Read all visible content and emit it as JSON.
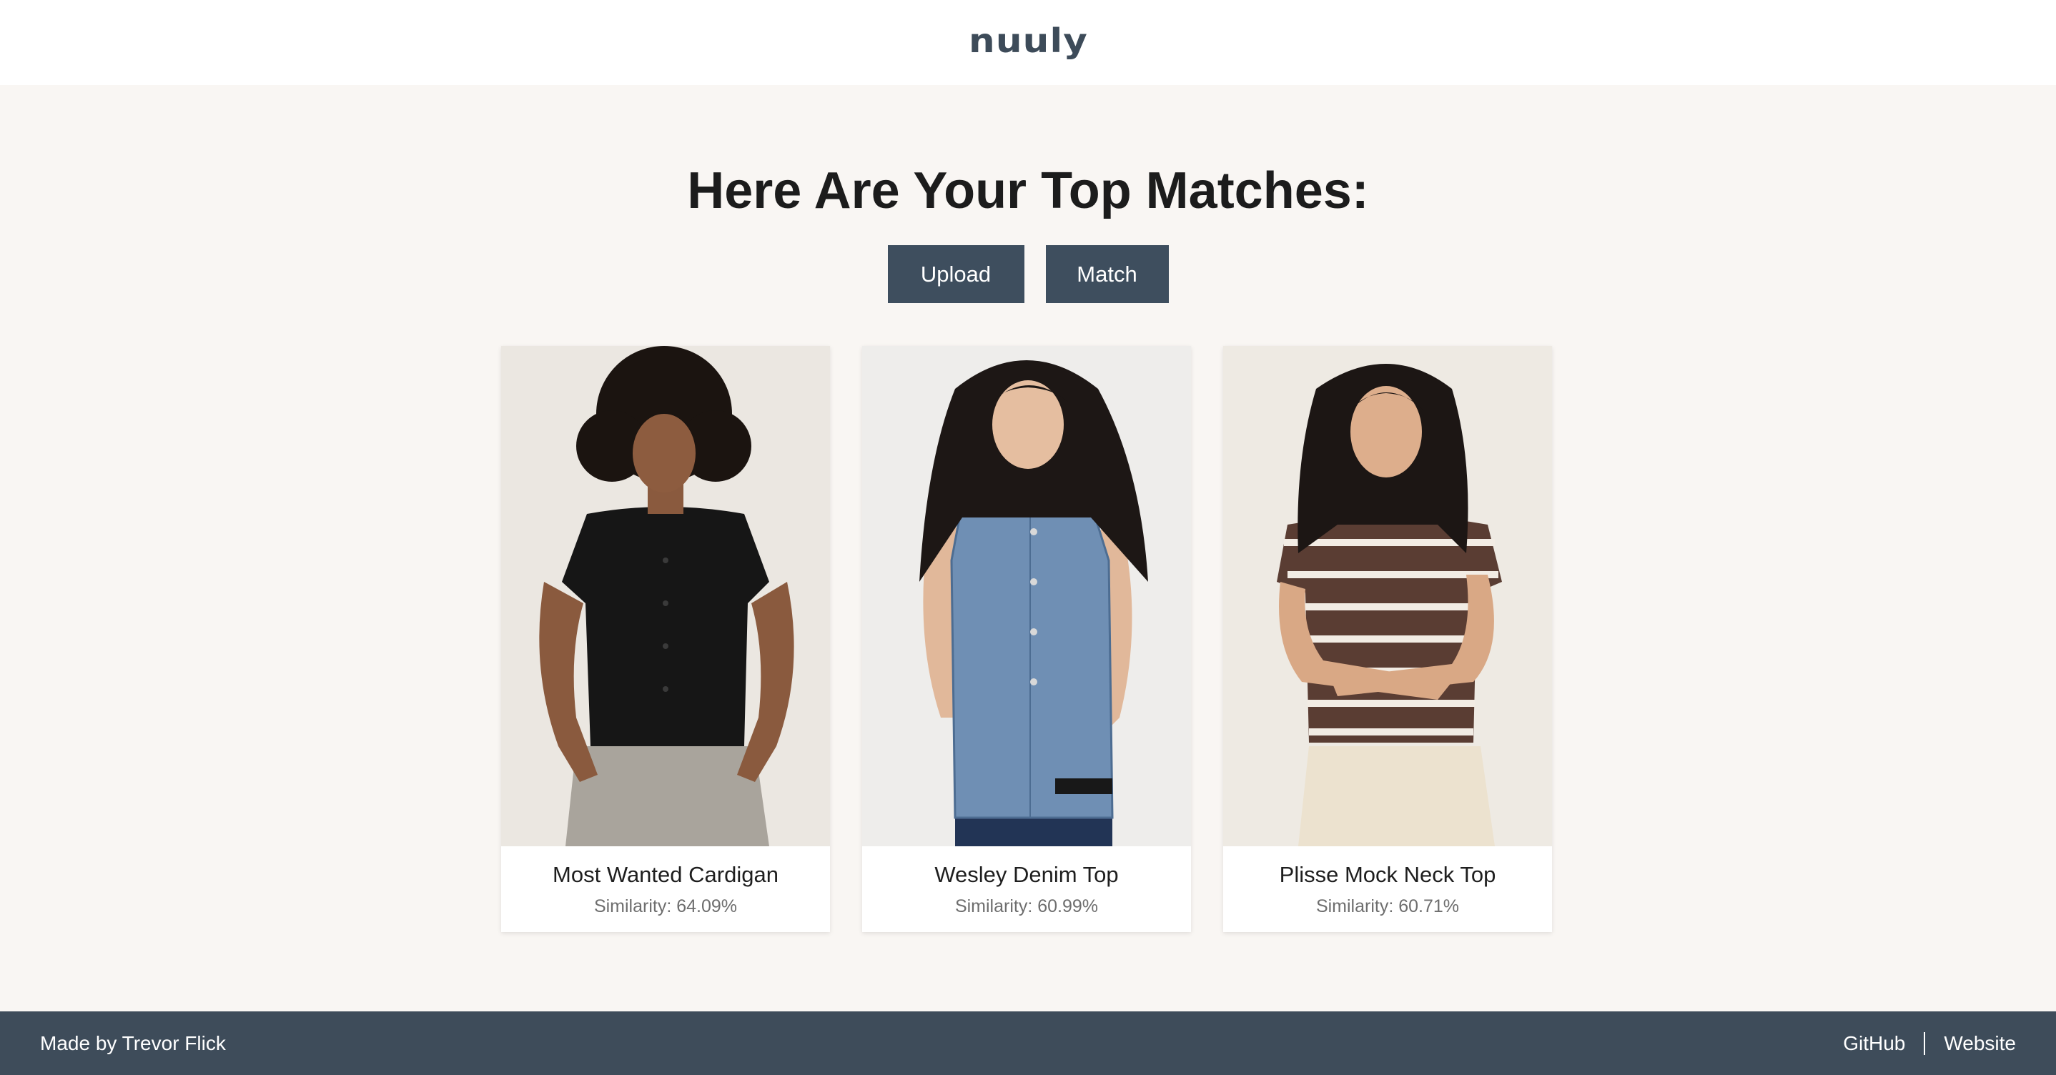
{
  "header": {
    "logo_text": "nuuly"
  },
  "main": {
    "title": "Here Are Your Top Matches:",
    "buttons": {
      "upload_label": "Upload",
      "match_label": "Match"
    },
    "results": [
      {
        "name": "Most Wanted Cardigan",
        "similarity": "Similarity: 64.09%",
        "image": "model-black-cardigan"
      },
      {
        "name": "Wesley Denim Top",
        "similarity": "Similarity: 60.99%",
        "image": "model-denim-vest"
      },
      {
        "name": "Plisse Mock Neck Top",
        "similarity": "Similarity: 60.71%",
        "image": "model-striped-top"
      }
    ]
  },
  "footer": {
    "credit": "Made by Trevor Flick",
    "links": {
      "github": "GitHub",
      "website": "Website"
    }
  },
  "colors": {
    "accent": "#3e4e5e",
    "page_bg": "#f9f6f3",
    "footer_bg": "#3e4c5a"
  }
}
